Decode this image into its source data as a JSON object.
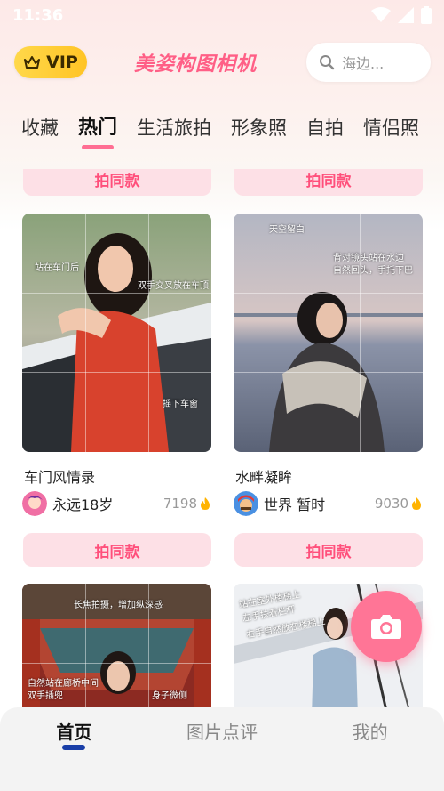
{
  "status_bar": {
    "time": "11:36"
  },
  "header": {
    "vip_label": "VIP",
    "app_title": "美姿构图相机",
    "search_placeholder": "海边..."
  },
  "tabs": [
    {
      "label": "收藏",
      "active": false
    },
    {
      "label": "热门",
      "active": true
    },
    {
      "label": "生活旅拍",
      "active": false
    },
    {
      "label": "形象照",
      "active": false
    },
    {
      "label": "自拍",
      "active": false
    },
    {
      "label": "情侣照",
      "active": false
    }
  ],
  "feed": {
    "same_style_label": "拍同款",
    "cards": [
      {
        "title": "车门风情录",
        "author": "永远18岁",
        "likes": "7198",
        "overlays": [
          "站在车门后",
          "双手交叉放在车顶",
          "摇下车窗"
        ]
      },
      {
        "title": "水畔凝眸",
        "author": "世界 暂时",
        "likes": "9030",
        "overlays": [
          "天空留白",
          "背对镜头站在水边",
          "自然回头，手托下巴"
        ]
      },
      {
        "title": "",
        "author": "",
        "likes": "",
        "overlays": [
          "长焦拍摄，增加纵深感",
          "自然站在廊桥中间",
          "双手插兜",
          "身子微侧"
        ]
      },
      {
        "title": "",
        "author": "",
        "likes": "",
        "overlays": [
          "站在室外楼梯上",
          "左手扶着栏杆",
          "右手自然放在楼梯上"
        ]
      }
    ]
  },
  "bottom_nav": [
    {
      "label": "首页",
      "active": true
    },
    {
      "label": "图片点评",
      "active": false
    },
    {
      "label": "我的",
      "active": false
    }
  ],
  "colors": {
    "accent": "#ff6e93",
    "vip": "#ffc425",
    "same_button_bg": "#fde0e6",
    "same_button_text": "#ff4f7b"
  }
}
